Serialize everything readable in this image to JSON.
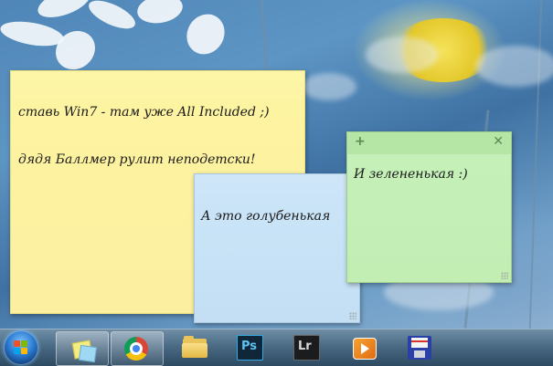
{
  "notes": {
    "yellow": {
      "line1": "ставь Win7 - там уже All Included ;)",
      "line2": "дядя Баллмер рулит неподетски!",
      "color": "#fdf3a0"
    },
    "blue": {
      "text": "А это голубенькая",
      "color": "#c9e3f7"
    },
    "green": {
      "text": "И зелененькая :)",
      "add_glyph": "+",
      "close_glyph": "✕",
      "color": "#c5f0b8"
    }
  },
  "taskbar": {
    "items": [
      {
        "name": "start-orb",
        "icon": "windows-flag-icon"
      },
      {
        "name": "sticky-notes",
        "icon": "sticky-notes-icon",
        "pinned": true
      },
      {
        "name": "chrome",
        "icon": "chrome-icon",
        "pinned": true
      },
      {
        "name": "explorer",
        "icon": "folder-icon"
      },
      {
        "name": "photoshop",
        "icon": "photoshop-icon",
        "label": "Ps"
      },
      {
        "name": "lightroom",
        "icon": "lightroom-icon",
        "label": "Lr"
      },
      {
        "name": "media-player",
        "icon": "media-player-icon"
      },
      {
        "name": "save",
        "icon": "floppy-disk-icon"
      }
    ]
  }
}
